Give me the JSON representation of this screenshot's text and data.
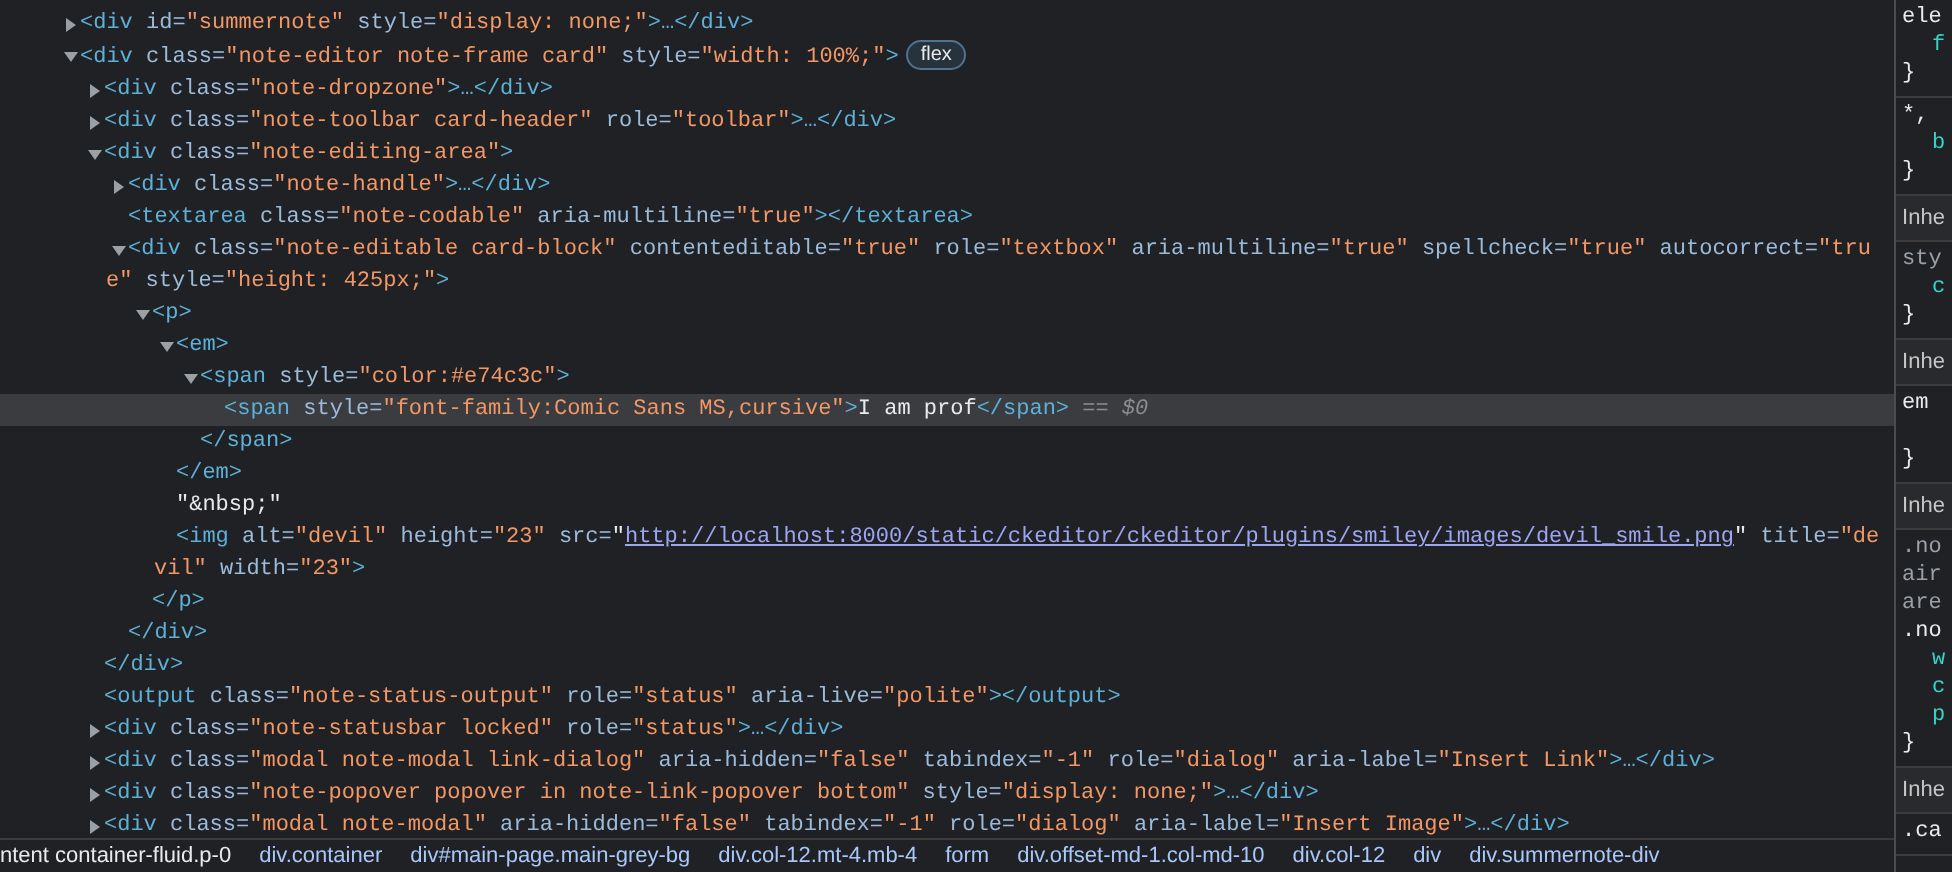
{
  "nodes": [
    {
      "selected": false,
      "expanded": false,
      "open": [
        {
          "kind": "tag",
          "text": "<div"
        },
        {
          "kind": "attr",
          "text": " id="
        },
        {
          "kind": "val",
          "text": "\"summernote\""
        },
        {
          "kind": "attr",
          "text": " style="
        },
        {
          "kind": "val",
          "text": "\"display: none;\""
        },
        {
          "kind": "tag",
          "text": ">…</div>"
        }
      ]
    },
    {
      "selected": false,
      "expanded": true,
      "badge": "flex",
      "open": [
        {
          "kind": "tag",
          "text": "<div"
        },
        {
          "kind": "attr",
          "text": " class="
        },
        {
          "kind": "val",
          "text": "\"note-editor note-frame card\""
        },
        {
          "kind": "attr",
          "text": " style="
        },
        {
          "kind": "val",
          "text": "\"width: 100%;\""
        },
        {
          "kind": "tag",
          "text": ">"
        }
      ],
      "children": [
        {
          "selected": false,
          "expanded": false,
          "open": [
            {
              "kind": "tag",
              "text": "<div"
            },
            {
              "kind": "attr",
              "text": " class="
            },
            {
              "kind": "val",
              "text": "\"note-dropzone\""
            },
            {
              "kind": "tag",
              "text": ">…</div>"
            }
          ]
        },
        {
          "selected": false,
          "expanded": false,
          "open": [
            {
              "kind": "tag",
              "text": "<div"
            },
            {
              "kind": "attr",
              "text": " class="
            },
            {
              "kind": "val",
              "text": "\"note-toolbar card-header\""
            },
            {
              "kind": "attr",
              "text": " role="
            },
            {
              "kind": "val",
              "text": "\"toolbar\""
            },
            {
              "kind": "tag",
              "text": ">…</div>"
            }
          ]
        },
        {
          "selected": false,
          "expanded": true,
          "open": [
            {
              "kind": "tag",
              "text": "<div"
            },
            {
              "kind": "attr",
              "text": " class="
            },
            {
              "kind": "val",
              "text": "\"note-editing-area\""
            },
            {
              "kind": "tag",
              "text": ">"
            }
          ],
          "close": [
            {
              "kind": "tag",
              "text": "</div>"
            }
          ],
          "children": [
            {
              "selected": false,
              "expanded": false,
              "open": [
                {
                  "kind": "tag",
                  "text": "<div"
                },
                {
                  "kind": "attr",
                  "text": " class="
                },
                {
                  "kind": "val",
                  "text": "\"note-handle\""
                },
                {
                  "kind": "tag",
                  "text": ">…</div>"
                }
              ]
            },
            {
              "selected": false,
              "open": [
                {
                  "kind": "tag",
                  "text": "<textarea"
                },
                {
                  "kind": "attr",
                  "text": " class="
                },
                {
                  "kind": "val",
                  "text": "\"note-codable\""
                },
                {
                  "kind": "attr",
                  "text": " aria-multiline="
                },
                {
                  "kind": "val",
                  "text": "\"true\""
                },
                {
                  "kind": "tag",
                  "text": "></textarea>"
                }
              ]
            },
            {
              "selected": false,
              "expanded": true,
              "open": [
                {
                  "kind": "tag",
                  "text": "<div"
                },
                {
                  "kind": "attr",
                  "text": " class="
                },
                {
                  "kind": "val",
                  "text": "\"note-editable card-block\""
                },
                {
                  "kind": "attr",
                  "text": " contenteditable="
                },
                {
                  "kind": "val",
                  "text": "\"true\""
                },
                {
                  "kind": "attr",
                  "text": " role="
                },
                {
                  "kind": "val",
                  "text": "\"textbox\""
                },
                {
                  "kind": "attr",
                  "text": " aria-multiline="
                },
                {
                  "kind": "val",
                  "text": "\"true\""
                },
                {
                  "kind": "attr",
                  "text": " spellcheck="
                },
                {
                  "kind": "val",
                  "text": "\"true\""
                },
                {
                  "kind": "attr",
                  "text": " autocorrect="
                },
                {
                  "kind": "val",
                  "text": "\"true\""
                },
                {
                  "kind": "attr",
                  "text": " style="
                },
                {
                  "kind": "val",
                  "text": "\"height: 425px;\""
                },
                {
                  "kind": "tag",
                  "text": ">"
                }
              ],
              "close": [
                {
                  "kind": "tag",
                  "text": "</div>"
                }
              ],
              "children": [
                {
                  "selected": false,
                  "expanded": true,
                  "open": [
                    {
                      "kind": "tag",
                      "text": "<p>"
                    }
                  ],
                  "close": [
                    {
                      "kind": "tag",
                      "text": "</p>"
                    }
                  ],
                  "children": [
                    {
                      "selected": false,
                      "expanded": true,
                      "open": [
                        {
                          "kind": "tag",
                          "text": "<em>"
                        }
                      ],
                      "close": [
                        {
                          "kind": "tag",
                          "text": "</em>"
                        }
                      ],
                      "children": [
                        {
                          "selected": false,
                          "expanded": true,
                          "open": [
                            {
                              "kind": "tag",
                              "text": "<span"
                            },
                            {
                              "kind": "attr",
                              "text": " style="
                            },
                            {
                              "kind": "val",
                              "text": "\"color:#e74c3c\""
                            },
                            {
                              "kind": "tag",
                              "text": ">"
                            }
                          ],
                          "close": [
                            {
                              "kind": "tag",
                              "text": "</span>"
                            }
                          ],
                          "children": [
                            {
                              "selected": true,
                              "open": [
                                {
                                  "kind": "tag",
                                  "text": "<span"
                                },
                                {
                                  "kind": "attr",
                                  "text": " style="
                                },
                                {
                                  "kind": "val",
                                  "text": "\"font-family:Comic Sans MS,cursive\""
                                },
                                {
                                  "kind": "tag",
                                  "text": ">"
                                },
                                {
                                  "kind": "text",
                                  "text": "I am prof"
                                },
                                {
                                  "kind": "tag",
                                  "text": "</span>"
                                },
                                {
                                  "kind": "dim",
                                  "text": " == $0"
                                }
                              ]
                            }
                          ]
                        }
                      ]
                    },
                    {
                      "selected": false,
                      "open": [
                        {
                          "kind": "text",
                          "text": "\"&nbsp;\""
                        }
                      ]
                    },
                    {
                      "selected": false,
                      "open": [
                        {
                          "kind": "tag",
                          "text": "<img"
                        },
                        {
                          "kind": "attr",
                          "text": " alt="
                        },
                        {
                          "kind": "val",
                          "text": "\"devil\""
                        },
                        {
                          "kind": "attr",
                          "text": " height="
                        },
                        {
                          "kind": "val",
                          "text": "\"23\""
                        },
                        {
                          "kind": "attr",
                          "text": " src="
                        },
                        {
                          "kind": "text",
                          "text": "\""
                        },
                        {
                          "kind": "link",
                          "text": "http://localhost:8000/static/ckeditor/ckeditor/plugins/smiley/images/devil_smile.png"
                        },
                        {
                          "kind": "text",
                          "text": "\""
                        },
                        {
                          "kind": "attr",
                          "text": " title="
                        },
                        {
                          "kind": "val",
                          "text": "\"devil\""
                        },
                        {
                          "kind": "attr",
                          "text": " width="
                        },
                        {
                          "kind": "val",
                          "text": "\"23\""
                        },
                        {
                          "kind": "tag",
                          "text": ">"
                        }
                      ]
                    }
                  ]
                }
              ]
            }
          ]
        },
        {
          "selected": false,
          "open": [
            {
              "kind": "tag",
              "text": "<output"
            },
            {
              "kind": "attr",
              "text": " class="
            },
            {
              "kind": "val",
              "text": "\"note-status-output\""
            },
            {
              "kind": "attr",
              "text": " role="
            },
            {
              "kind": "val",
              "text": "\"status\""
            },
            {
              "kind": "attr",
              "text": " aria-live="
            },
            {
              "kind": "val",
              "text": "\"polite\""
            },
            {
              "kind": "tag",
              "text": "></output>"
            }
          ]
        },
        {
          "selected": false,
          "expanded": false,
          "open": [
            {
              "kind": "tag",
              "text": "<div"
            },
            {
              "kind": "attr",
              "text": " class="
            },
            {
              "kind": "val",
              "text": "\"note-statusbar locked\""
            },
            {
              "kind": "attr",
              "text": " role="
            },
            {
              "kind": "val",
              "text": "\"status\""
            },
            {
              "kind": "tag",
              "text": ">…</div>"
            }
          ]
        },
        {
          "selected": false,
          "expanded": false,
          "open": [
            {
              "kind": "tag",
              "text": "<div"
            },
            {
              "kind": "attr",
              "text": " class="
            },
            {
              "kind": "val",
              "text": "\"modal note-modal link-dialog\""
            },
            {
              "kind": "attr",
              "text": " aria-hidden="
            },
            {
              "kind": "val",
              "text": "\"false\""
            },
            {
              "kind": "attr",
              "text": " tabindex="
            },
            {
              "kind": "val",
              "text": "\"-1\""
            },
            {
              "kind": "attr",
              "text": " role="
            },
            {
              "kind": "val",
              "text": "\"dialog\""
            },
            {
              "kind": "attr",
              "text": " aria-label="
            },
            {
              "kind": "val",
              "text": "\"Insert Link\""
            },
            {
              "kind": "tag",
              "text": ">…</div>"
            }
          ]
        },
        {
          "selected": false,
          "expanded": false,
          "open": [
            {
              "kind": "tag",
              "text": "<div"
            },
            {
              "kind": "attr",
              "text": " class="
            },
            {
              "kind": "val",
              "text": "\"note-popover popover in note-link-popover bottom\""
            },
            {
              "kind": "attr",
              "text": " style="
            },
            {
              "kind": "val",
              "text": "\"display: none;\""
            },
            {
              "kind": "tag",
              "text": ">…</div>"
            }
          ]
        },
        {
          "selected": false,
          "expanded": false,
          "open": [
            {
              "kind": "tag",
              "text": "<div"
            },
            {
              "kind": "attr",
              "text": " class="
            },
            {
              "kind": "val",
              "text": "\"modal note-modal\""
            },
            {
              "kind": "attr",
              "text": " aria-hidden="
            },
            {
              "kind": "val",
              "text": "\"false\""
            },
            {
              "kind": "attr",
              "text": " tabindex="
            },
            {
              "kind": "val",
              "text": "\"-1\""
            },
            {
              "kind": "attr",
              "text": " role="
            },
            {
              "kind": "val",
              "text": "\"dialog\""
            },
            {
              "kind": "attr",
              "text": " aria-label="
            },
            {
              "kind": "val",
              "text": "\"Insert Image\""
            },
            {
              "kind": "tag",
              "text": ">…</div>"
            }
          ]
        }
      ]
    }
  ],
  "breadcrumbs": [
    "ntent container-fluid.p-0",
    "div.container",
    "div#main-page.main-grey-bg",
    "div.col-12.mt-4.mb-4",
    "form",
    "div.offset-md-1.col-md-10",
    "div.col-12",
    "div",
    "div.summernote-div"
  ],
  "styles": [
    {
      "kind": "rule",
      "lines": [
        {
          "kind": "sel",
          "text": "ele"
        },
        {
          "kind": "prop",
          "text": "f"
        },
        {
          "kind": "brace",
          "text": "}"
        }
      ]
    },
    {
      "kind": "rule",
      "lines": [
        {
          "kind": "sel",
          "text": "*,"
        },
        {
          "kind": "prop",
          "text": "b"
        },
        {
          "kind": "brace",
          "text": "}"
        }
      ]
    },
    {
      "kind": "header",
      "text": "Inhe"
    },
    {
      "kind": "rule",
      "lines": [
        {
          "kind": "src",
          "text": "sty"
        },
        {
          "kind": "prop",
          "text": "c"
        },
        {
          "kind": "brace",
          "text": "}"
        }
      ]
    },
    {
      "kind": "header",
      "text": "Inhe"
    },
    {
      "kind": "rule",
      "lines": [
        {
          "kind": "sel",
          "text": "em"
        },
        {
          "kind": "brace",
          "text": "}"
        }
      ]
    },
    {
      "kind": "header",
      "text": "Inhe"
    },
    {
      "kind": "rule",
      "lines": [
        {
          "kind": "src",
          "text": ".no"
        },
        {
          "kind": "src",
          "text": "air"
        },
        {
          "kind": "src",
          "text": "are"
        },
        {
          "kind": "sel",
          "text": ".no"
        },
        {
          "kind": "prop",
          "text": "w"
        },
        {
          "kind": "prop",
          "text": "c"
        },
        {
          "kind": "prop",
          "text": "p"
        },
        {
          "kind": "brace",
          "text": "}"
        }
      ]
    },
    {
      "kind": "header",
      "text": "Inhe"
    },
    {
      "kind": "rule",
      "lines": [
        {
          "kind": "sel",
          "text": ".ca"
        }
      ]
    }
  ]
}
